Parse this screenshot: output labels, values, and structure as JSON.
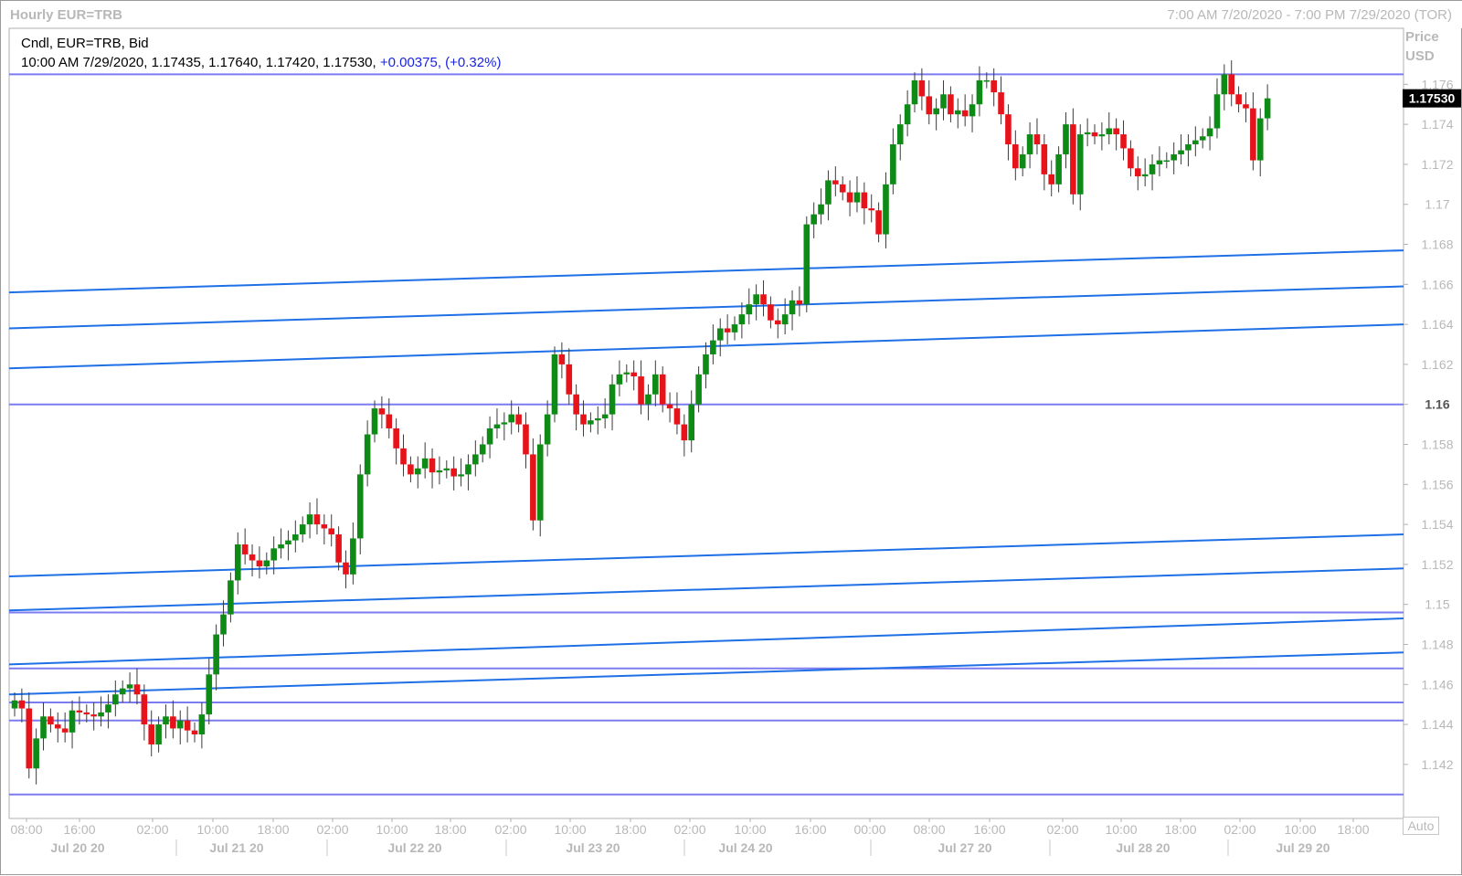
{
  "window": {
    "title": "Hourly EUR=TRB",
    "range": "7:00 AM 7/20/2020 - 7:00 PM 7/29/2020 (TOR)"
  },
  "legend": {
    "line1": "Cndl, EUR=TRB, Bid",
    "ohlc": "10:00 AM 7/29/2020, 1.17435, 1.17640, 1.17420, 1.17530,",
    "change": "+0.00375, (+0.32%)"
  },
  "price_axis": {
    "header_line1": "Price",
    "header_line2": "USD",
    "last_price": "1.17530",
    "auto_label": "Auto"
  },
  "colors": {
    "up": "#0e8a16",
    "down": "#e6131b",
    "horizontal_line": "#7b7cf0",
    "trend_line": "#1f6fe6",
    "grid": "#dcdcdc",
    "axis_text": "#b8b8b8"
  },
  "chart_data": {
    "type": "candlestick",
    "title": "Hourly EUR=TRB",
    "ylabel": "Price USD",
    "ylim": [
      1.1393,
      1.1788
    ],
    "y_ticks": [
      "1.142",
      "1.144",
      "1.146",
      "1.148",
      "1.15",
      "1.152",
      "1.154",
      "1.156",
      "1.158",
      "1.16",
      "1.162",
      "1.164",
      "1.166",
      "1.168",
      "1.17",
      "1.172",
      "1.174",
      "1.176"
    ],
    "x_time_ticks": [
      "08:00",
      "16:00",
      "02:00",
      "10:00",
      "18:00",
      "02:00",
      "10:00",
      "18:00",
      "02:00",
      "10:00",
      "18:00",
      "02:00",
      "10:00",
      "16:00",
      "00:00",
      "08:00",
      "16:00",
      "02:00",
      "10:00",
      "18:00",
      "02:00",
      "10:00",
      "18:00"
    ],
    "x_date_ticks": [
      "Jul 20 20",
      "Jul 21 20",
      "Jul 22 20",
      "Jul 23 20",
      "Jul 24 20",
      "Jul 27 20",
      "Jul 28 20",
      "Jul 29 20"
    ],
    "horizontal_levels": [
      1.1765,
      1.16,
      1.1496,
      1.1468,
      1.1451,
      1.1442,
      1.1405
    ],
    "trend_lines": [
      {
        "start": 1.1656,
        "end": 1.1677
      },
      {
        "start": 1.1638,
        "end": 1.1659
      },
      {
        "start": 1.1618,
        "end": 1.164
      },
      {
        "start": 1.1514,
        "end": 1.1535
      },
      {
        "start": 1.1497,
        "end": 1.1518
      },
      {
        "start": 1.147,
        "end": 1.1493
      },
      {
        "start": 1.1455,
        "end": 1.1476
      }
    ],
    "x_range": "7:00 AM 7/20/2020 - 7:00 PM 7/29/2020",
    "closes": [
      1.1452,
      1.1448,
      1.1418,
      1.1433,
      1.1444,
      1.144,
      1.1438,
      1.1436,
      1.1447,
      1.1446,
      1.1445,
      1.1444,
      1.1446,
      1.145,
      1.1455,
      1.1458,
      1.146,
      1.1455,
      1.144,
      1.143,
      1.144,
      1.1444,
      1.1438,
      1.1442,
      1.1437,
      1.1435,
      1.1445,
      1.1465,
      1.1485,
      1.1495,
      1.1512,
      1.153,
      1.1525,
      1.1522,
      1.1519,
      1.1522,
      1.1528,
      1.153,
      1.1532,
      1.1535,
      1.154,
      1.1545,
      1.154,
      1.1538,
      1.1535,
      1.1521,
      1.1515,
      1.1533,
      1.1565,
      1.1585,
      1.1598,
      1.1595,
      1.1588,
      1.1578,
      1.157,
      1.1565,
      1.1568,
      1.1573,
      1.1566,
      1.1567,
      1.1568,
      1.1564,
      1.1565,
      1.157,
      1.1575,
      1.158,
      1.1588,
      1.159,
      1.1591,
      1.1595,
      1.159,
      1.1575,
      1.1542,
      1.158,
      1.1595,
      1.1625,
      1.162,
      1.1605,
      1.1595,
      1.159,
      1.1592,
      1.1593,
      1.1595,
      1.161,
      1.1615,
      1.1616,
      1.1614,
      1.16,
      1.1605,
      1.1615,
      1.16,
      1.1598,
      1.159,
      1.1582,
      1.16,
      1.1615,
      1.1625,
      1.1632,
      1.1638,
      1.1636,
      1.164,
      1.1645,
      1.165,
      1.1655,
      1.165,
      1.1642,
      1.164,
      1.1645,
      1.1652,
      1.165,
      1.169,
      1.1695,
      1.17,
      1.1712,
      1.171,
      1.1706,
      1.1701,
      1.1706,
      1.1698,
      1.1697,
      1.1685,
      1.171,
      1.173,
      1.174,
      1.175,
      1.1762,
      1.1754,
      1.1745,
      1.1748,
      1.1755,
      1.1745,
      1.1747,
      1.1744,
      1.175,
      1.1762,
      1.1762,
      1.1756,
      1.1745,
      1.173,
      1.1718,
      1.1725,
      1.1735,
      1.173,
      1.1715,
      1.171,
      1.1725,
      1.174,
      1.1705,
      1.1735,
      1.1736,
      1.1734,
      1.1735,
      1.1738,
      1.1735,
      1.1728,
      1.1718,
      1.1714,
      1.1715,
      1.172,
      1.1722,
      1.1722,
      1.1725,
      1.1727,
      1.173,
      1.1732,
      1.1734,
      1.1738,
      1.1755,
      1.1765,
      1.1755,
      1.175,
      1.1748,
      1.1722,
      1.1743,
      1.1753
    ]
  }
}
